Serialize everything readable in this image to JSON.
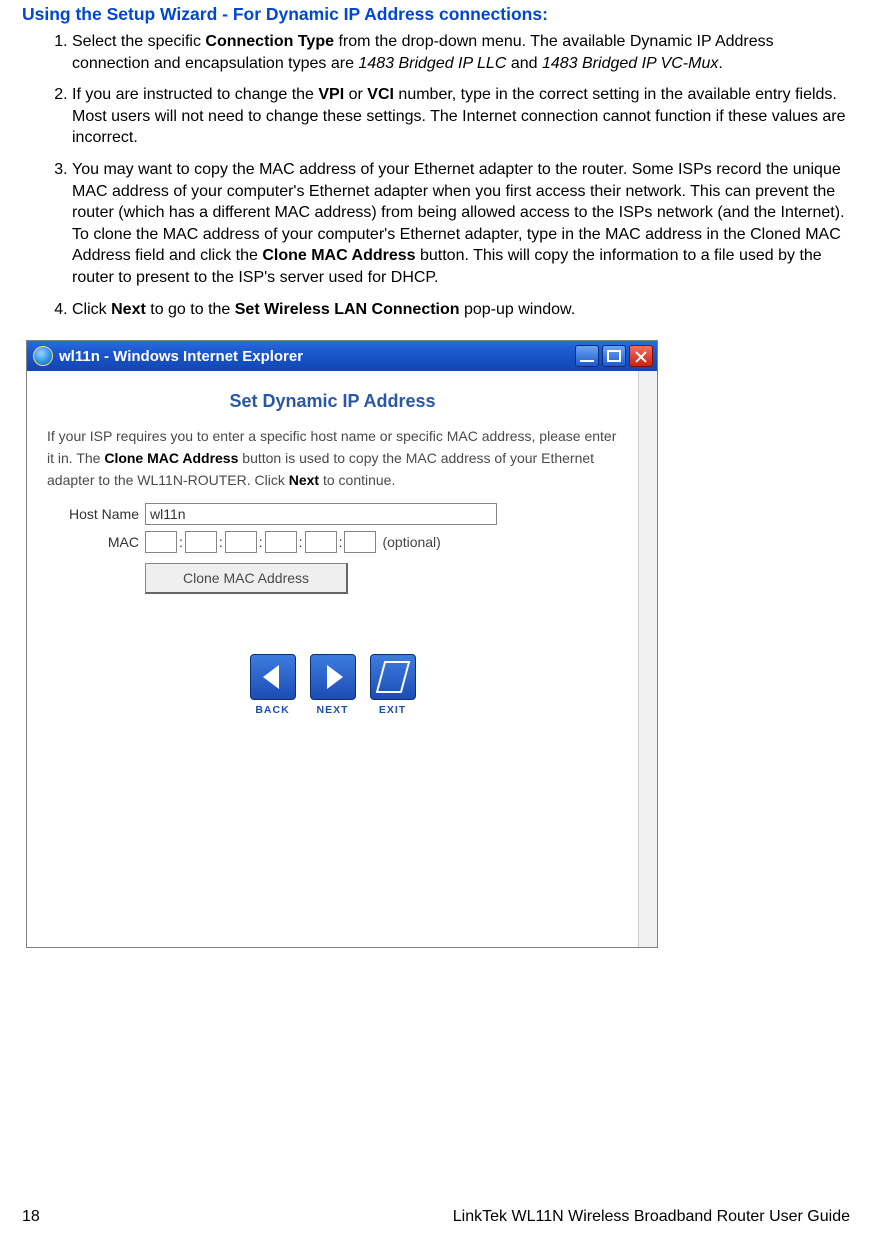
{
  "heading": "Using the Setup Wizard - For Dynamic IP Address connections:",
  "steps": {
    "s1": {
      "pre": "Select the specific ",
      "b1": "Connection Type",
      "mid1": " from the drop-down menu. The available Dynamic IP Address connection and encapsulation types are ",
      "i1": "1483 Bridged IP LLC",
      "mid2": " and ",
      "i2": "1483 Bridged IP VC-Mux",
      "post": "."
    },
    "s2": {
      "pre": "If you are instructed to change the ",
      "b1": "VPI",
      "mid1": " or ",
      "b2": "VCI",
      "post": " number, type in the correct setting in the available entry fields. Most users will not need to change these settings. The Internet connection cannot function if these values are incorrect."
    },
    "s3": {
      "pre": "You may want to copy the MAC address of your Ethernet adapter to the router. Some ISPs record the unique MAC address of your computer's Ethernet adapter when you first access their network. This can prevent the router (which has a different MAC address) from being allowed access to the ISPs network (and the Internet). To clone the MAC address of your computer's Ethernet adapter, type in the MAC address in the Cloned MAC Address field and click the ",
      "b1": "Clone MAC Address",
      "post": " button. This will copy the information to a file used by the router to present to the ISP's server used for DHCP."
    },
    "s4": {
      "pre": "Click ",
      "b1": "Next",
      "mid1": " to go to the ",
      "b2": "Set Wireless LAN Connection",
      "post": " pop-up window."
    }
  },
  "window": {
    "title": "wl11n - Windows Internet Explorer",
    "wizard_title": "Set Dynamic IP Address",
    "desc_pre": "If your ISP requires you to enter a specific host name or specific MAC address, please enter it in. The ",
    "desc_b1": "Clone MAC Address",
    "desc_mid": " button is used to copy the MAC address of your Ethernet adapter to the WL11N-ROUTER. Click ",
    "desc_b2": "Next",
    "desc_post": " to continue.",
    "host_label": "Host Name",
    "host_value": "wl11n",
    "mac_label": "MAC",
    "sep": ":",
    "optional": "(optional)",
    "clone_btn": "Clone MAC Address",
    "nav": {
      "back": "BACK",
      "next": "NEXT",
      "exit": "EXIT"
    }
  },
  "footer": {
    "page": "18",
    "title": "LinkTek WL11N Wireless Broadband Router User Guide"
  }
}
